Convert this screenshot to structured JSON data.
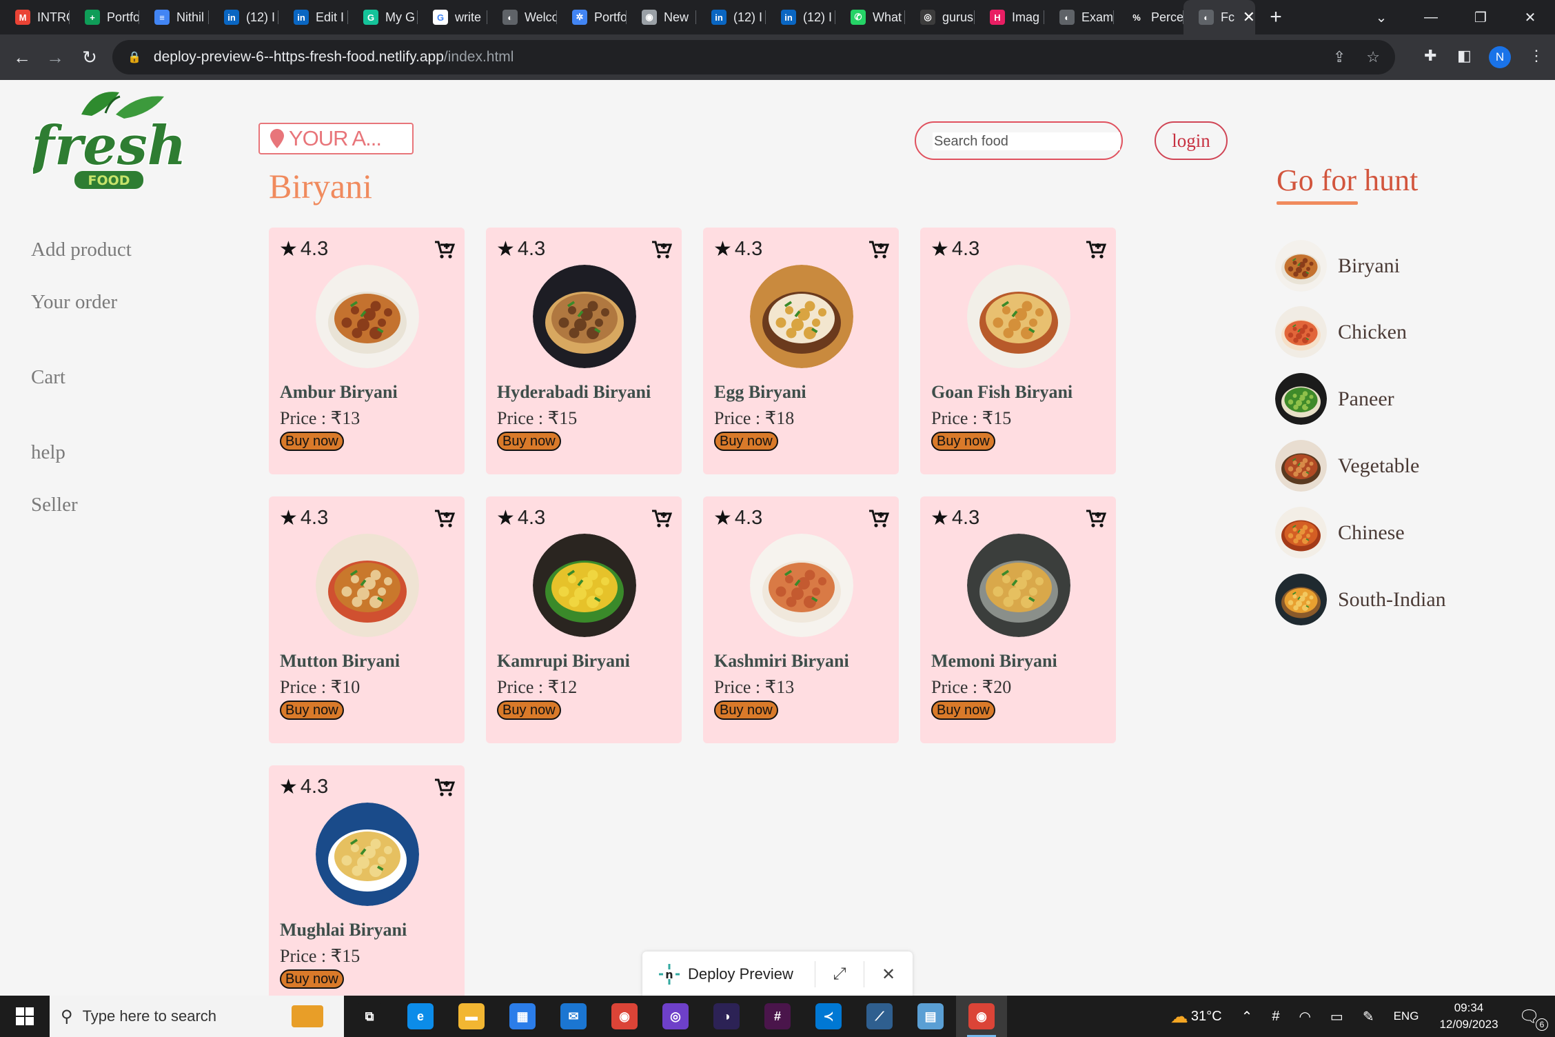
{
  "browser": {
    "tabs": [
      {
        "title": "INTRO",
        "icon": "gmail-icon",
        "color": "#ea4335",
        "glyph": "M"
      },
      {
        "title": "Portfo",
        "icon": "sheets-icon",
        "color": "#0f9d58",
        "glyph": "+"
      },
      {
        "title": "Nithil",
        "icon": "docs-icon",
        "color": "#4285f4",
        "glyph": "≡"
      },
      {
        "title": "(12) I",
        "icon": "linkedin-icon",
        "color": "#0a66c2",
        "glyph": "in"
      },
      {
        "title": "Edit I",
        "icon": "linkedin-icon",
        "color": "#0a66c2",
        "glyph": "in"
      },
      {
        "title": "My G",
        "icon": "grammarly-icon",
        "color": "#15c39a",
        "glyph": "G"
      },
      {
        "title": "write",
        "icon": "google-icon",
        "color": "#ffffff",
        "glyph": "G"
      },
      {
        "title": "Welco",
        "icon": "globe-icon",
        "color": "#5f6368",
        "glyph": "◐"
      },
      {
        "title": "Portfo",
        "icon": "gear-icon",
        "color": "#4285f4",
        "glyph": "✲"
      },
      {
        "title": "New",
        "icon": "chrome-icon",
        "color": "#9aa0a6",
        "glyph": "◉"
      },
      {
        "title": "(12) I",
        "icon": "linkedin-icon",
        "color": "#0a66c2",
        "glyph": "in"
      },
      {
        "title": "(12) I",
        "icon": "linkedin-icon",
        "color": "#0a66c2",
        "glyph": "in"
      },
      {
        "title": "What",
        "icon": "whatsapp-icon",
        "color": "#25d366",
        "glyph": "✆"
      },
      {
        "title": "gurus",
        "icon": "github-icon",
        "color": "#3c3c3c",
        "glyph": "◎"
      },
      {
        "title": "Imag",
        "icon": "h-icon",
        "color": "#e91e63",
        "glyph": "H"
      },
      {
        "title": "Exam",
        "icon": "globe-icon",
        "color": "#5f6368",
        "glyph": "◐"
      },
      {
        "title": "Perce",
        "icon": "percent-icon",
        "color": "#202124",
        "glyph": "%"
      }
    ],
    "active_tab": {
      "title": "Fc",
      "icon": "globe-icon"
    },
    "url_host": "deploy-preview-6--https-fresh-food.netlify.app",
    "url_path": "/index.html",
    "profile_initial": "N"
  },
  "logo": {
    "word": "fresh",
    "sub": "FOOD"
  },
  "sidebar": {
    "add_product": "Add product",
    "your_order": "Your order",
    "cart": "Cart",
    "help": "help",
    "seller": "Seller"
  },
  "header": {
    "address_label": "YOUR A...",
    "search_placeholder": "Search food",
    "login": "login",
    "category_title": "Biryani"
  },
  "products": [
    {
      "rating": "4.3",
      "name": "Ambur Biryani",
      "price": "Price : ₹13",
      "buy": "Buy now",
      "img": "a"
    },
    {
      "rating": "4.3",
      "name": "Hyderabadi Biryani",
      "price": "Price : ₹15",
      "buy": "Buy now",
      "img": "b"
    },
    {
      "rating": "4.3",
      "name": "Egg Biryani",
      "price": "Price : ₹18",
      "buy": "Buy now",
      "img": "c"
    },
    {
      "rating": "4.3",
      "name": "Goan Fish Biryani",
      "price": "Price : ₹15",
      "buy": "Buy now",
      "img": "d"
    },
    {
      "rating": "4.3",
      "name": "Mutton Biryani",
      "price": "Price : ₹10",
      "buy": "Buy now",
      "img": "e"
    },
    {
      "rating": "4.3",
      "name": "Kamrupi Biryani",
      "price": "Price : ₹12",
      "buy": "Buy now",
      "img": "f"
    },
    {
      "rating": "4.3",
      "name": "Kashmiri Biryani",
      "price": "Price : ₹13",
      "buy": "Buy now",
      "img": "g"
    },
    {
      "rating": "4.3",
      "name": "Memoni Biryani",
      "price": "Price : ₹20",
      "buy": "Buy now",
      "img": "h"
    },
    {
      "rating": "4.3",
      "name": "Mughlai Biryani",
      "price": "Price : ₹15",
      "buy": "Buy now",
      "img": "i"
    }
  ],
  "hunt": {
    "title": "Go for hunt",
    "items": [
      {
        "label": "Biryani",
        "img": "a"
      },
      {
        "label": "Chicken",
        "img": "j"
      },
      {
        "label": "Paneer",
        "img": "k"
      },
      {
        "label": "Vegetable",
        "img": "l"
      },
      {
        "label": "Chinese",
        "img": "m"
      },
      {
        "label": "South-Indian",
        "img": "n"
      }
    ]
  },
  "deploy_preview": {
    "label": "Deploy Preview"
  },
  "taskbar": {
    "search_placeholder": "Type here to search",
    "apps": [
      {
        "name": "task-view-icon",
        "color": "#1c1c1c",
        "glyph": "⧉"
      },
      {
        "name": "edge-icon",
        "color": "#0c8ce9",
        "glyph": "e"
      },
      {
        "name": "file-explorer-icon",
        "color": "#f2b632",
        "glyph": "▬"
      },
      {
        "name": "store-icon",
        "color": "#2b7de9",
        "glyph": "▦"
      },
      {
        "name": "mail-icon",
        "color": "#1b76d2",
        "glyph": "✉"
      },
      {
        "name": "chrome-icon",
        "color": "#db4437",
        "glyph": "◉"
      },
      {
        "name": "github-desktop-icon",
        "color": "#6e40c9",
        "glyph": "◎"
      },
      {
        "name": "eclipse-icon",
        "color": "#2c2255",
        "glyph": "◑"
      },
      {
        "name": "slack-icon",
        "color": "#4a154b",
        "glyph": "#"
      },
      {
        "name": "vscode-icon",
        "color": "#0078d4",
        "glyph": "≺"
      },
      {
        "name": "mysql-workbench-icon",
        "color": "#2f5f8f",
        "glyph": "⟋"
      },
      {
        "name": "notepad-icon",
        "color": "#5a9fd4",
        "glyph": "▤"
      },
      {
        "name": "chrome-profile-icon",
        "color": "#db4437",
        "glyph": "◉"
      }
    ],
    "weather": "31°C",
    "language": "ENG",
    "time": "09:34",
    "date": "12/09/2023",
    "notifications": "6"
  }
}
